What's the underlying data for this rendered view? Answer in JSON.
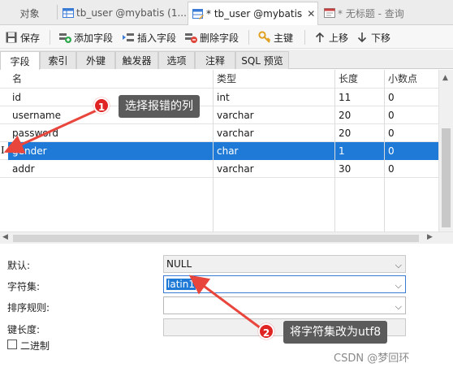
{
  "window_tabs": {
    "objects_label": "对象",
    "tab1_label": "tb_user @mybatis (1...",
    "tab2_label": "* tb_user @mybatis",
    "tab3_label": "* 无标题 - 查询"
  },
  "toolbar": {
    "save": "保存",
    "add_field": "添加字段",
    "insert_field": "插入字段",
    "delete_field": "删除字段",
    "primary_key": "主键",
    "move_up": "上移",
    "move_down": "下移"
  },
  "sub_tabs": [
    "字段",
    "索引",
    "外键",
    "触发器",
    "选项",
    "注释",
    "SQL 预览"
  ],
  "grid": {
    "headers": [
      "名",
      "类型",
      "长度",
      "小数点"
    ],
    "rows": [
      {
        "name": "id",
        "type": "int",
        "length": "11",
        "decimals": "0"
      },
      {
        "name": "username",
        "type": "varchar",
        "length": "20",
        "decimals": "0"
      },
      {
        "name": "password",
        "type": "varchar",
        "length": "20",
        "decimals": "0"
      },
      {
        "name": "gender",
        "type": "char",
        "length": "1",
        "decimals": "0"
      },
      {
        "name": "addr",
        "type": "varchar",
        "length": "30",
        "decimals": "0"
      }
    ],
    "selected_row_marker": "I"
  },
  "properties": {
    "default_label": "默认:",
    "default_value": "NULL",
    "charset_label": "字符集:",
    "charset_value": "latin1",
    "collation_label": "排序规则:",
    "collation_value": "",
    "key_length_label": "键长度:",
    "binary_label": "二进制"
  },
  "annotations": {
    "step1_number": "1",
    "step1_text": "选择报错的列",
    "step2_number": "2",
    "step2_text": "将字符集改为utf8"
  },
  "watermark": "CSDN @梦回环",
  "colors": {
    "selection": "#1e7ad6",
    "callout_bg": "#5b5b5b",
    "badge_red": "#e02323",
    "arrow_red": "#e8463c"
  }
}
